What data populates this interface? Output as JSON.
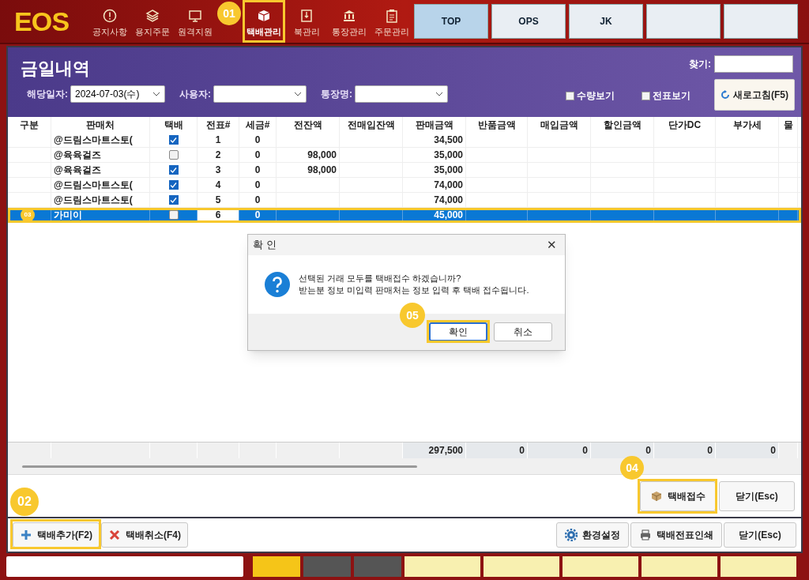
{
  "app_bar": {
    "logo": "EOS",
    "menu": [
      {
        "label": "공지사항",
        "selected": false
      },
      {
        "label": "용지주문",
        "selected": false
      },
      {
        "label": "원격지원",
        "selected": false
      },
      {
        "label": "택배관리",
        "selected": true
      },
      {
        "label": "북관리",
        "selected": false
      },
      {
        "label": "통장관리",
        "selected": false
      },
      {
        "label": "주문관리",
        "selected": false
      }
    ],
    "tabs": [
      {
        "label": "TOP",
        "selected": true
      },
      {
        "label": "OPS",
        "selected": false
      },
      {
        "label": "JK",
        "selected": false
      }
    ]
  },
  "window": {
    "title": "금일내역",
    "search_label": "찾기:",
    "filters": [
      {
        "label": "해당일자:",
        "value": "2024-07-03(수)"
      },
      {
        "label": "사용자:"
      },
      {
        "label": "통장명:"
      }
    ],
    "checkboxes": [
      {
        "label": "수량보기",
        "checked": false
      },
      {
        "label": "전표보기",
        "checked": false
      }
    ],
    "refresh_button": "새로고침(F5)"
  },
  "table": {
    "columns": [
      "구분",
      "판매처",
      "택배",
      "전표#",
      "세금#",
      "전잔액",
      "전매입잔액",
      "판매금액",
      "반품금액",
      "매입금액",
      "할인금액",
      "단가DC",
      "부가세",
      "물"
    ],
    "rows": [
      {
        "seller": "@드림스마트스토(",
        "delivery": true,
        "slip": "1",
        "tax": "0",
        "sales": "34,500",
        "selected": false
      },
      {
        "seller": "@육육걸즈",
        "delivery": false,
        "slip": "2",
        "tax": "0",
        "prev_balance": "98,000",
        "sales": "35,000",
        "selected": false
      },
      {
        "seller": "@육육걸즈",
        "delivery": true,
        "slip": "3",
        "tax": "0",
        "prev_balance": "98,000",
        "sales": "35,000",
        "selected": false
      },
      {
        "seller": "@드림스마트스토(",
        "delivery": true,
        "slip": "4",
        "tax": "0",
        "sales": "74,000",
        "selected": false
      },
      {
        "seller": "@드림스마트스토(",
        "delivery": true,
        "slip": "5",
        "tax": "0",
        "sales": "74,000",
        "selected": false
      },
      {
        "seller": "가미이",
        "delivery": false,
        "slip": "6",
        "tax": "0",
        "sales": "45,000",
        "selected": true
      }
    ],
    "totals": {
      "sales": "297,500",
      "returns": "0",
      "purchases": "0",
      "discounts": "0",
      "unit_dc": "0",
      "vat": "0"
    }
  },
  "window_buttons": [
    {
      "label": "택배접수"
    },
    {
      "label": "닫기(Esc)"
    }
  ],
  "toolbar": {
    "left": [
      {
        "label": "택배추가(F2)"
      },
      {
        "label": "택배취소(F4)"
      }
    ],
    "right": [
      {
        "label": "환경설정"
      },
      {
        "label": "택배전표인쇄"
      },
      {
        "label": "닫기(Esc)"
      }
    ]
  },
  "dialog": {
    "title": "확 인",
    "close": "✕",
    "message": [
      "선택된 거래 모두를 택배접수 하겠습니까?",
      "받는분 정보 미입력 판매처는 정보 입력 후 택배 접수됩니다."
    ],
    "buttons": [
      {
        "label": "확인",
        "default": true
      },
      {
        "label": "취소",
        "default": false
      }
    ]
  },
  "callouts": [
    {
      "label": "01"
    },
    {
      "label": "02"
    },
    {
      "label": "03"
    },
    {
      "label": "04"
    },
    {
      "label": "05"
    }
  ]
}
